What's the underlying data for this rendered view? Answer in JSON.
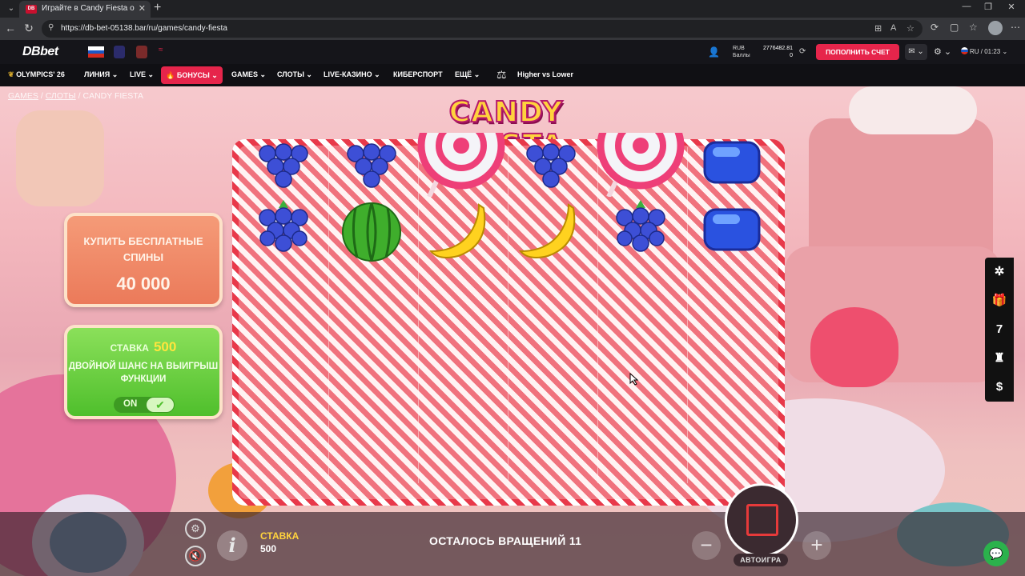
{
  "browser": {
    "tab_title": "Играйте в Candy Fiesta онлайн",
    "tab_favicon": "DB",
    "url": "https://db-bet-05138.bar/ru/games/candy-fiesta"
  },
  "site": {
    "logo": "DBbet",
    "balance_currency": "RUB",
    "balance_points_label": "Баллы",
    "balance_amount": "2776482.81",
    "balance_points": "0",
    "deposit_label": "ПОПОЛНИТЬ СЧЕТ",
    "lang_time": "RU / 01:23",
    "nav": [
      {
        "label": "OLYMPICS' 26"
      },
      {
        "label": "ЛИНИЯ"
      },
      {
        "label": "LIVE"
      },
      {
        "label": "БОНУСЫ"
      },
      {
        "label": "GAMES"
      },
      {
        "label": "СЛОТЫ"
      },
      {
        "label": "LIVE-КАЗИНО"
      },
      {
        "label": "КИБЕРСПОРТ"
      },
      {
        "label": "ЕЩЁ"
      },
      {
        "label": "Higher vs Lower"
      }
    ]
  },
  "breadcrumb": {
    "items": [
      "GAMES",
      "СЛОТЫ",
      "CANDY FIESTA"
    ]
  },
  "game": {
    "logo_text": "CANDY FIESTA",
    "buy_feature": {
      "title": "КУПИТЬ БЕСПЛАТНЫЕ СПИНЫ",
      "price": "40 000"
    },
    "ante_bet": {
      "label": "СТАВКА",
      "value": "500",
      "text": "ДВОЙНОЙ ШАНС НА ВЫИГРЫШ ФУНКЦИИ",
      "toggle_label": "ON"
    },
    "grid_symbols": [
      [
        "grape",
        "grape",
        "lollipop",
        "grape",
        "lollipop",
        "blue-candy"
      ],
      [
        "grape",
        "watermelon",
        "banana",
        "banana",
        "grape",
        "blue-candy"
      ]
    ],
    "side_menu": [
      "bug-icon",
      "gift-icon",
      "seven-icon",
      "rocket-icon",
      "dollar-icon"
    ],
    "side_menu_seven": "7"
  },
  "controls": {
    "bet_label": "СТАВКА",
    "bet_value": "500",
    "spins_left": "ОСТАЛОСЬ ВРАЩЕНИЙ 11",
    "autoplay": "АВТОИГРА",
    "minus": "−",
    "plus": "+"
  },
  "colors": {
    "accent": "#e6254b",
    "buy_panel": "#eb7a5a",
    "bet_panel": "#4fbf2c",
    "bet_highlight": "#ffd33d"
  }
}
